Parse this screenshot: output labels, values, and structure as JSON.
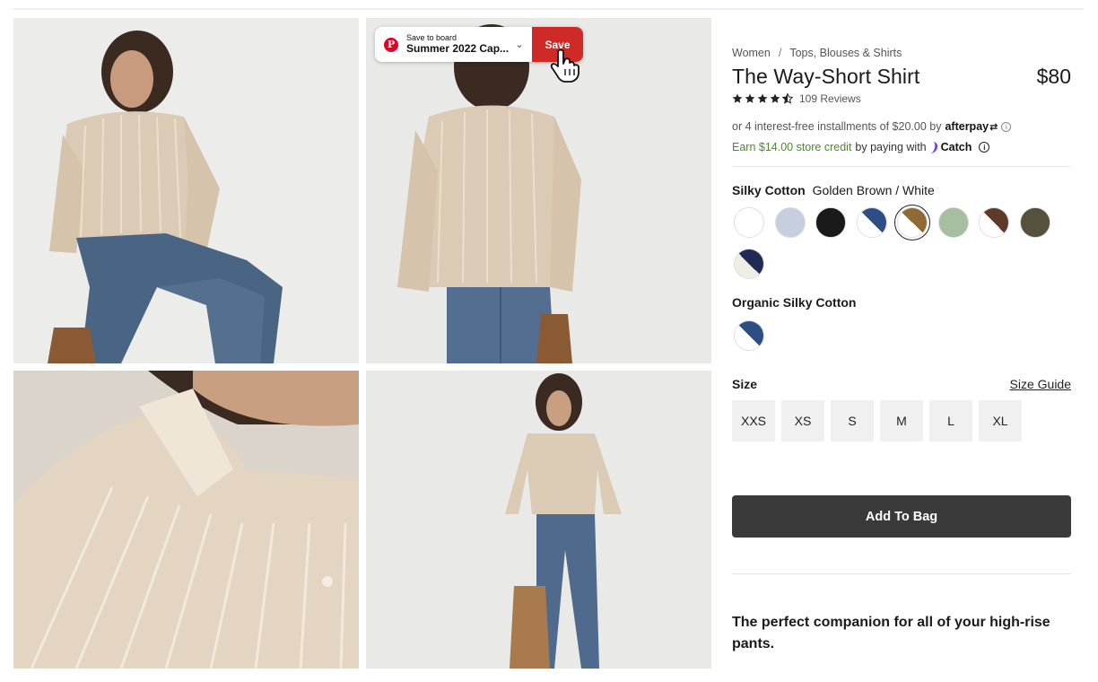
{
  "pinterest": {
    "save_to_board_label": "Save to board",
    "board_name": "Summer 2022 Cap...",
    "save_button": "Save"
  },
  "product": {
    "breadcrumb": [
      "Women",
      "Tops, Blouses & Shirts"
    ],
    "title": "The Way-Short Shirt",
    "price": "$80",
    "rating": 4.5,
    "reviews_label": "109 Reviews",
    "afterpay_text": "or 4 interest-free installments of $20.00 by",
    "afterpay_logo": "afterpay",
    "catch_green": "Earn $14.00 store credit",
    "catch_text": "by paying with",
    "catch_logo": "Catch",
    "fabric1_label": "Silky Cotton",
    "selected_color": "Golden Brown / White",
    "fabric2_label": "Organic Silky Cotton",
    "size_label": "Size",
    "size_guide": "Size Guide",
    "sizes": [
      "XXS",
      "XS",
      "S",
      "M",
      "L",
      "XL"
    ],
    "add_to_bag": "Add To Bag",
    "tagline": "The perfect companion for all of your high-rise pants."
  },
  "swatches_silky": [
    {
      "name": "white",
      "a": "#ffffff",
      "b": "#ffffff"
    },
    {
      "name": "light-blue",
      "a": "#c6cfdd",
      "b": "#c6cfdd"
    },
    {
      "name": "black",
      "a": "#1a1a1a",
      "b": "#1a1a1a"
    },
    {
      "name": "navy-white",
      "a": "#2e4d85",
      "b": "#ffffff"
    },
    {
      "name": "golden-brown-white",
      "a": "#8f6a34",
      "b": "#ffffff",
      "selected": true
    },
    {
      "name": "sage",
      "a": "#a7bea0",
      "b": "#a7bea0"
    },
    {
      "name": "brown-white",
      "a": "#5e3a2a",
      "b": "#ffffff"
    },
    {
      "name": "olive",
      "a": "#55513c",
      "b": "#55513c"
    },
    {
      "name": "dark-navy-cream",
      "a": "#1f2b55",
      "b": "#efeee4"
    }
  ],
  "swatches_organic": [
    {
      "name": "navy-white",
      "a": "#2e4d85",
      "b": "#ffffff"
    }
  ],
  "colors": {
    "pinterest_red": "#cf2a27",
    "catch_green": "#4a8a2a",
    "catch_purple": "#7b3fe4",
    "button_dark": "#3a3a3a"
  }
}
